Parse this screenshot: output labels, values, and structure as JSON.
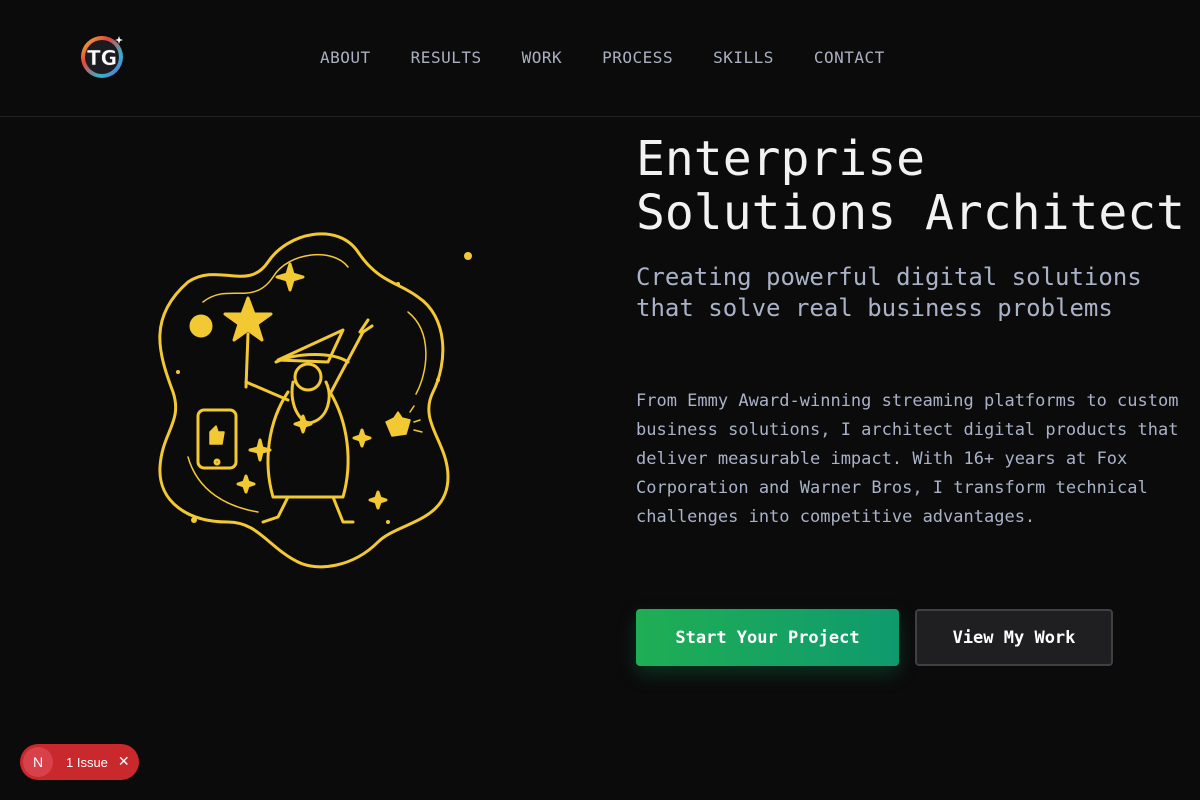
{
  "header": {
    "logo_text": "TG",
    "nav": [
      {
        "label": "ABOUT"
      },
      {
        "label": "RESULTS"
      },
      {
        "label": "WORK"
      },
      {
        "label": "PROCESS"
      },
      {
        "label": "SKILLS"
      },
      {
        "label": "CONTACT"
      }
    ]
  },
  "hero": {
    "title_line1": "Enterprise",
    "title_line2": "Solutions Architect",
    "subtitle": "Creating powerful digital solutions that solve real business problems",
    "body": "From Emmy Award-winning streaming platforms to custom business solutions, I architect digital products that deliver measurable impact. With 16+ years at Fox Corporation and Warner Bros, I transform technical challenges into competitive advantages.",
    "primary_button": "Start Your Project",
    "secondary_button": "View My Work"
  },
  "dev_overlay": {
    "avatar_letter": "N",
    "issue_label": "1 Issue",
    "close_symbol": "✕"
  },
  "colors": {
    "background": "#0b0b0c",
    "accent_green": "#1fae54",
    "illustration_yellow": "#f2c933",
    "issue_red": "#c9282d"
  }
}
